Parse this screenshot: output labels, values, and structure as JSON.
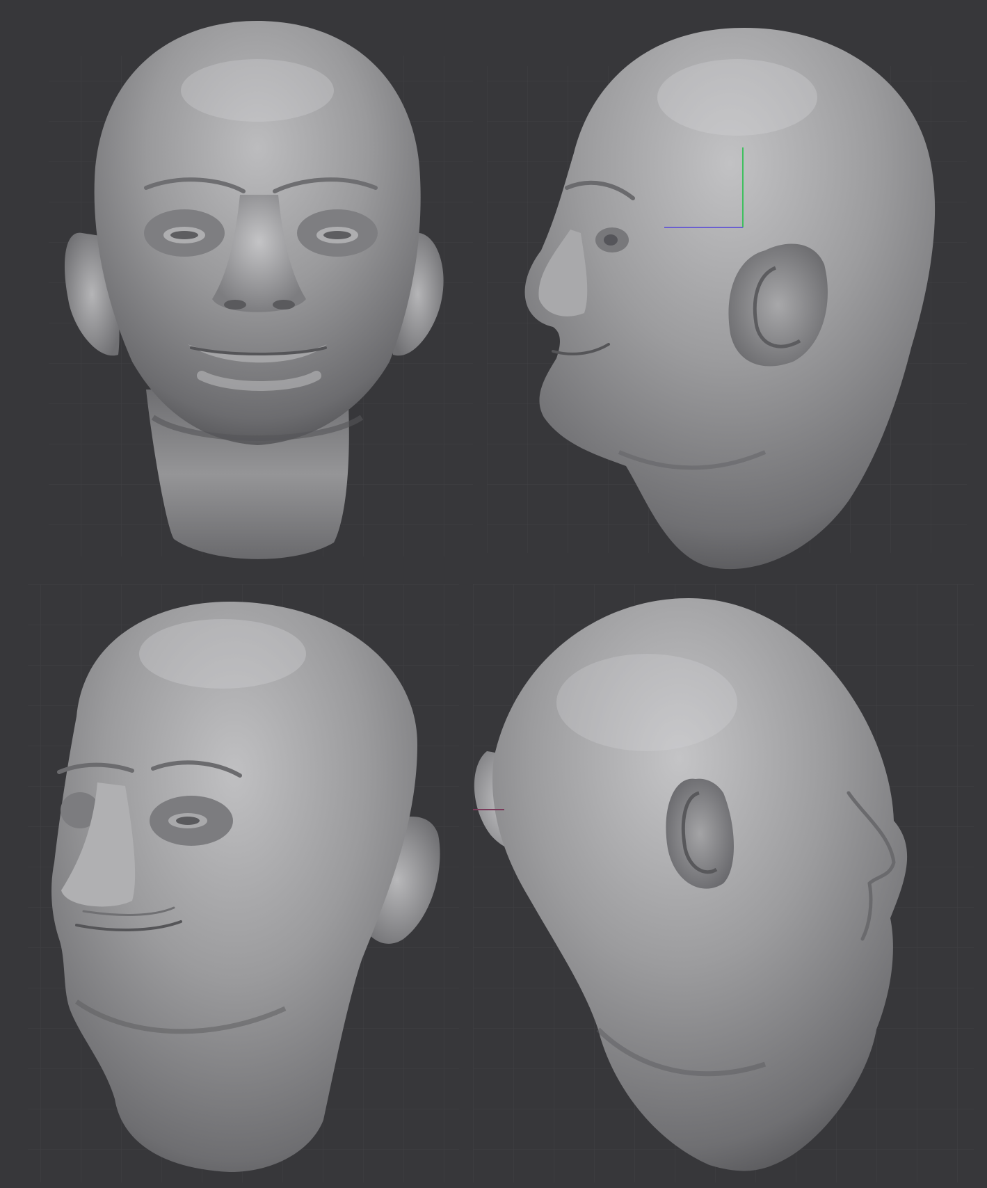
{
  "workspace": {
    "background_color": "#353538",
    "grid_color": "#3f3f43",
    "clay_base_color": "#8f8f91",
    "clay_highlight_color": "#cfcfd1",
    "clay_shadow_color": "#4a4a4d"
  },
  "views": [
    {
      "id": "front",
      "subject": "bald-head-sculpt-front-view"
    },
    {
      "id": "side",
      "subject": "bald-head-sculpt-right-profile-view"
    },
    {
      "id": "three-quarter",
      "subject": "bald-head-sculpt-three-quarter-view"
    },
    {
      "id": "back",
      "subject": "bald-head-sculpt-back-three-quarter-view"
    }
  ],
  "axis_gizmo": {
    "vertical_axis_color": "#3fbf5f",
    "horizontal_axis_color": "#6a5fd0"
  }
}
